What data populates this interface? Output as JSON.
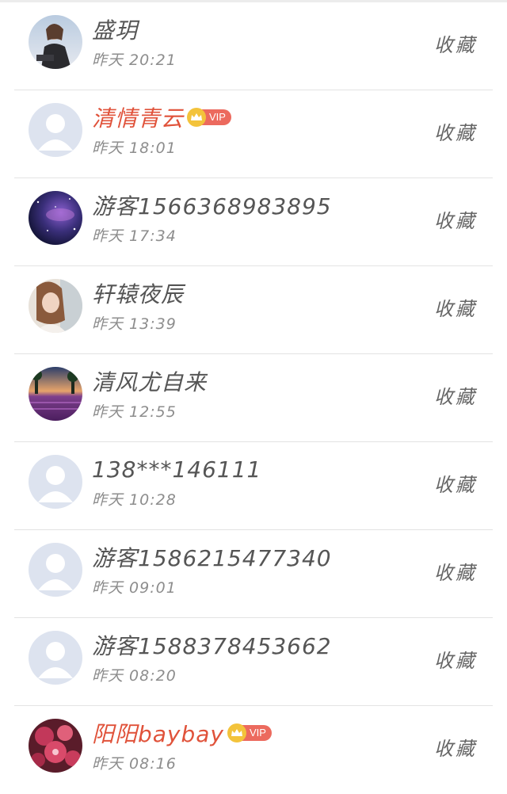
{
  "items": [
    {
      "name": "盛玥",
      "time": "昨天 20:21",
      "vip": false,
      "action": "收藏",
      "avatar": "photo-woman-sitting"
    },
    {
      "name": "清情青云",
      "time": "昨天 18:01",
      "vip": true,
      "vip_label": "VIP",
      "action": "收藏",
      "avatar": "default-user"
    },
    {
      "name": "游客1566368983895",
      "time": "昨天 17:34",
      "vip": false,
      "action": "收藏",
      "avatar": "photo-galaxy"
    },
    {
      "name": "轩辕夜辰",
      "time": "昨天 13:39",
      "vip": false,
      "action": "收藏",
      "avatar": "photo-girl"
    },
    {
      "name": "清风尤自来",
      "time": "昨天 12:55",
      "vip": false,
      "action": "收藏",
      "avatar": "photo-lavender-field"
    },
    {
      "name": "138***146111",
      "time": "昨天 10:28",
      "vip": false,
      "action": "收藏",
      "avatar": "default-user"
    },
    {
      "name": "游客1586215477340",
      "time": "昨天 09:01",
      "vip": false,
      "action": "收藏",
      "avatar": "default-user"
    },
    {
      "name": "游客1588378453662",
      "time": "昨天 08:20",
      "vip": false,
      "action": "收藏",
      "avatar": "default-user"
    },
    {
      "name": "阳阳baybay",
      "time": "昨天 08:16",
      "vip": true,
      "vip_label": "VIP",
      "action": "收藏",
      "avatar": "photo-red-flowers"
    }
  ],
  "colors": {
    "vip_name": "#e0523a",
    "vip_tag": "#ec6a5e",
    "crown": "#f3c33b",
    "name": "#555555",
    "time": "#8d8d8d",
    "divider": "#e3e3e3",
    "default_avatar_bg": "#dde3ef",
    "default_avatar_fg": "#ffffff"
  }
}
